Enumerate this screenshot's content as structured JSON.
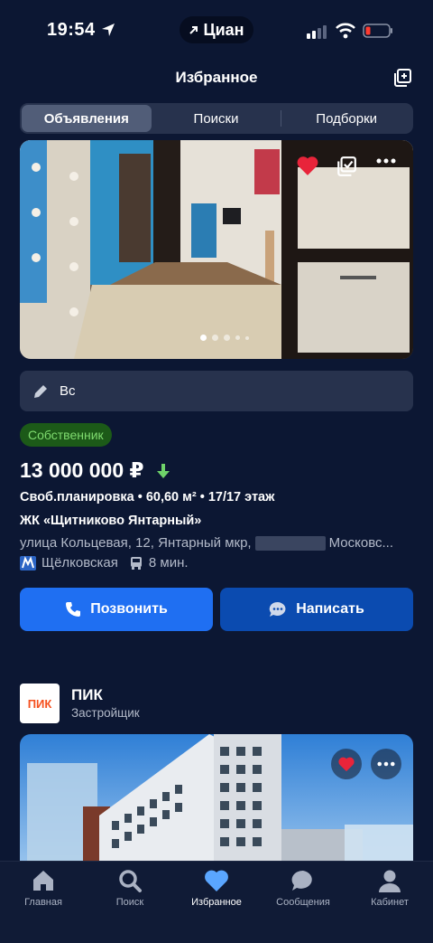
{
  "status_bar": {
    "time": "19:54",
    "app_name": "Циан"
  },
  "header": {
    "title": "Избранное"
  },
  "tabs": [
    {
      "label": "Объявления",
      "active": true
    },
    {
      "label": "Поиски",
      "active": false
    },
    {
      "label": "Подборки",
      "active": false
    }
  ],
  "listing": {
    "note": "Вс",
    "badge": "Собственник",
    "price": "13 000 000 ₽",
    "info": "Своб.планировка  •  60,60 м²  •  17/17 этаж",
    "complex": "ЖК «Щитниково Янтарный»",
    "address_start": "улица Кольцевая, 12, Янтарный мкр,",
    "address_end": "Московс...",
    "metro_station": "Щёлковская",
    "travel_time": "8 мин.",
    "call_label": "Позвонить",
    "write_label": "Написать",
    "photo_count_dots": 5,
    "photo_active_index": 0
  },
  "developer": {
    "logo_text": "ПИК",
    "name": "ПИК",
    "role": "Застройщик"
  },
  "nav": [
    {
      "label": "Главная",
      "icon": "home-icon",
      "active": false
    },
    {
      "label": "Поиск",
      "icon": "search-icon",
      "active": false
    },
    {
      "label": "Избранное",
      "icon": "heart-icon",
      "active": true
    },
    {
      "label": "Сообщения",
      "icon": "chat-icon",
      "active": false
    },
    {
      "label": "Кабинет",
      "icon": "user-icon",
      "active": false
    }
  ],
  "colors": {
    "background": "#0c1733",
    "primary_button": "#1f6ff2",
    "secondary_button": "#0b4bb0",
    "badge_bg": "#1c5a18",
    "badge_text": "#7fdb6f",
    "favorite_red": "#e8243a",
    "nav_active": "#5aa6ff"
  }
}
